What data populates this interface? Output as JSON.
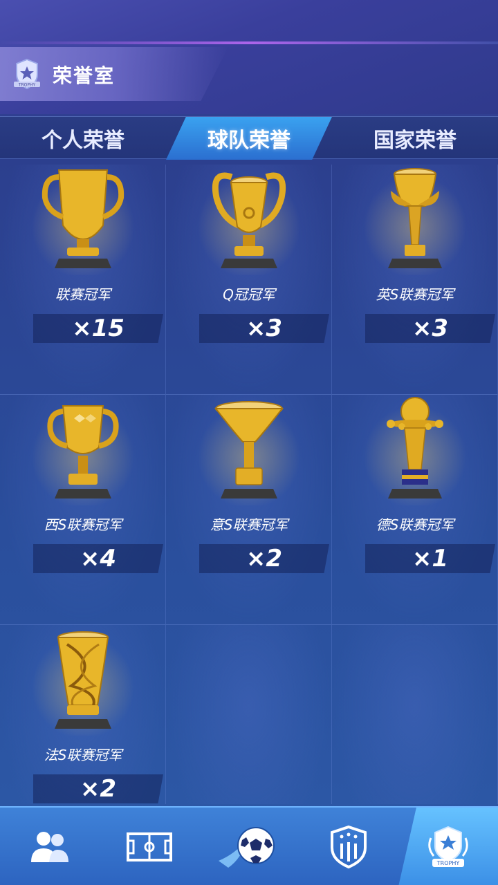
{
  "header": {
    "title": "荣誉室",
    "icon": "trophy-badge-icon",
    "icon_text": "TROPHY"
  },
  "tabs": [
    {
      "label": "个人荣誉",
      "active": false
    },
    {
      "label": "球队荣誉",
      "active": true
    },
    {
      "label": "国家荣誉",
      "active": false
    }
  ],
  "trophies": [
    {
      "name": "联赛冠军",
      "count": "×15",
      "icon": "league-cup-icon"
    },
    {
      "name": "Q冠冠军",
      "count": "×3",
      "icon": "champions-cup-icon"
    },
    {
      "name": "英S联赛冠军",
      "count": "×3",
      "icon": "winged-cup-icon"
    },
    {
      "name": "西S联赛冠军",
      "count": "×4",
      "icon": "laliga-cup-icon"
    },
    {
      "name": "意S联赛冠军",
      "count": "×2",
      "icon": "serie-cup-icon"
    },
    {
      "name": "德S联赛冠军",
      "count": "×1",
      "icon": "bundesliga-cup-icon"
    },
    {
      "name": "法S联赛冠军",
      "count": "×2",
      "icon": "ligue-cup-icon"
    }
  ],
  "bottom_nav": [
    {
      "icon": "players-icon",
      "active": false
    },
    {
      "icon": "pitch-icon",
      "active": false
    },
    {
      "icon": "football-icon",
      "active": false
    },
    {
      "icon": "club-shield-icon",
      "active": false
    },
    {
      "icon": "trophy-badge-icon",
      "active": true,
      "icon_text": "TROPHY"
    }
  ],
  "colors": {
    "gold": "#e8b62a",
    "active_tab": "#3aa2f0",
    "nav_bg": "#3f82d8"
  }
}
